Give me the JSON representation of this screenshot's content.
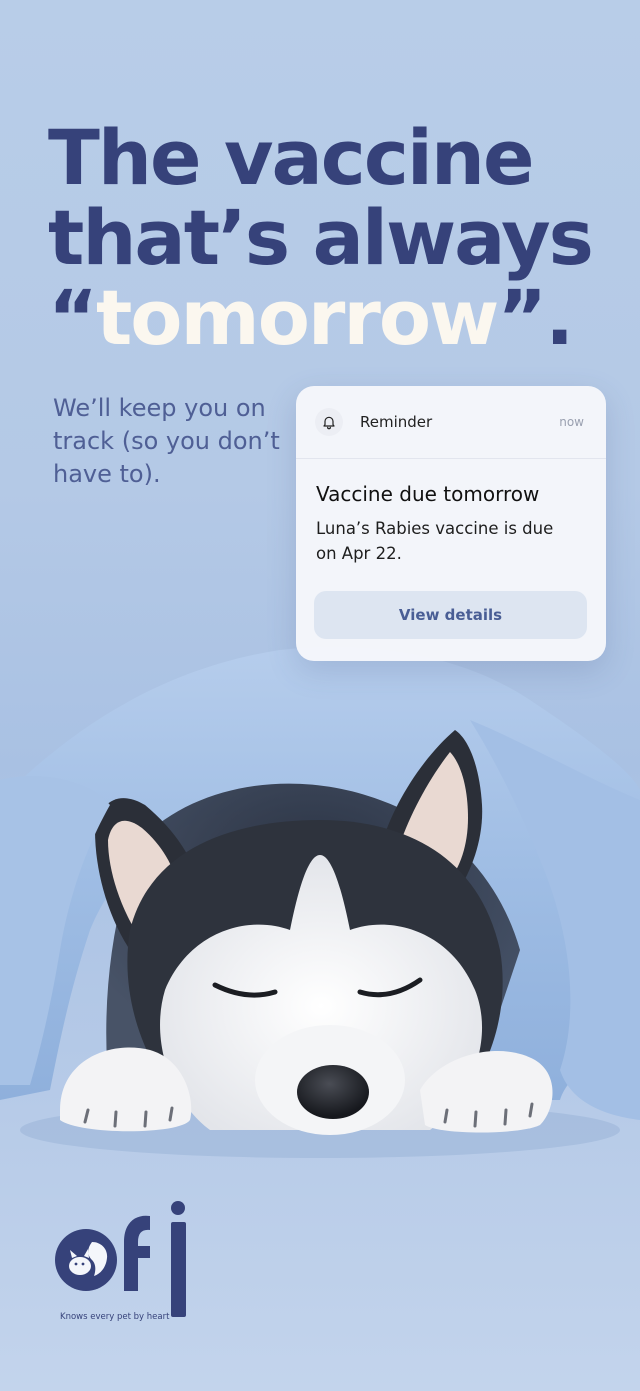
{
  "headline": {
    "line1": "The vaccine",
    "line2": "that’s always",
    "open_quote": "“",
    "highlight": "tomorrow",
    "close_quote": "”."
  },
  "subtext": "We’ll keep you on track (so you don’t have to).",
  "notification": {
    "app_name": "Reminder",
    "time": "now",
    "icon": "bell-icon",
    "title": "Vaccine due tomorrow",
    "body": "Luna’s Rabies vaccine is due on Apr 22.",
    "button_label": "View details"
  },
  "photo": {
    "subject": "husky-under-blanket"
  },
  "brand": {
    "logo": "ofi-logo",
    "tagline": "Knows every pet by heart"
  },
  "colors": {
    "background": "#b4c9e6",
    "headline": "#36427a",
    "highlight": "#fbf7ef",
    "subtext": "#4f5f95",
    "button_bg": "#dde5f1",
    "button_text": "#4a5e95",
    "blanket": "#a9c4e6"
  }
}
